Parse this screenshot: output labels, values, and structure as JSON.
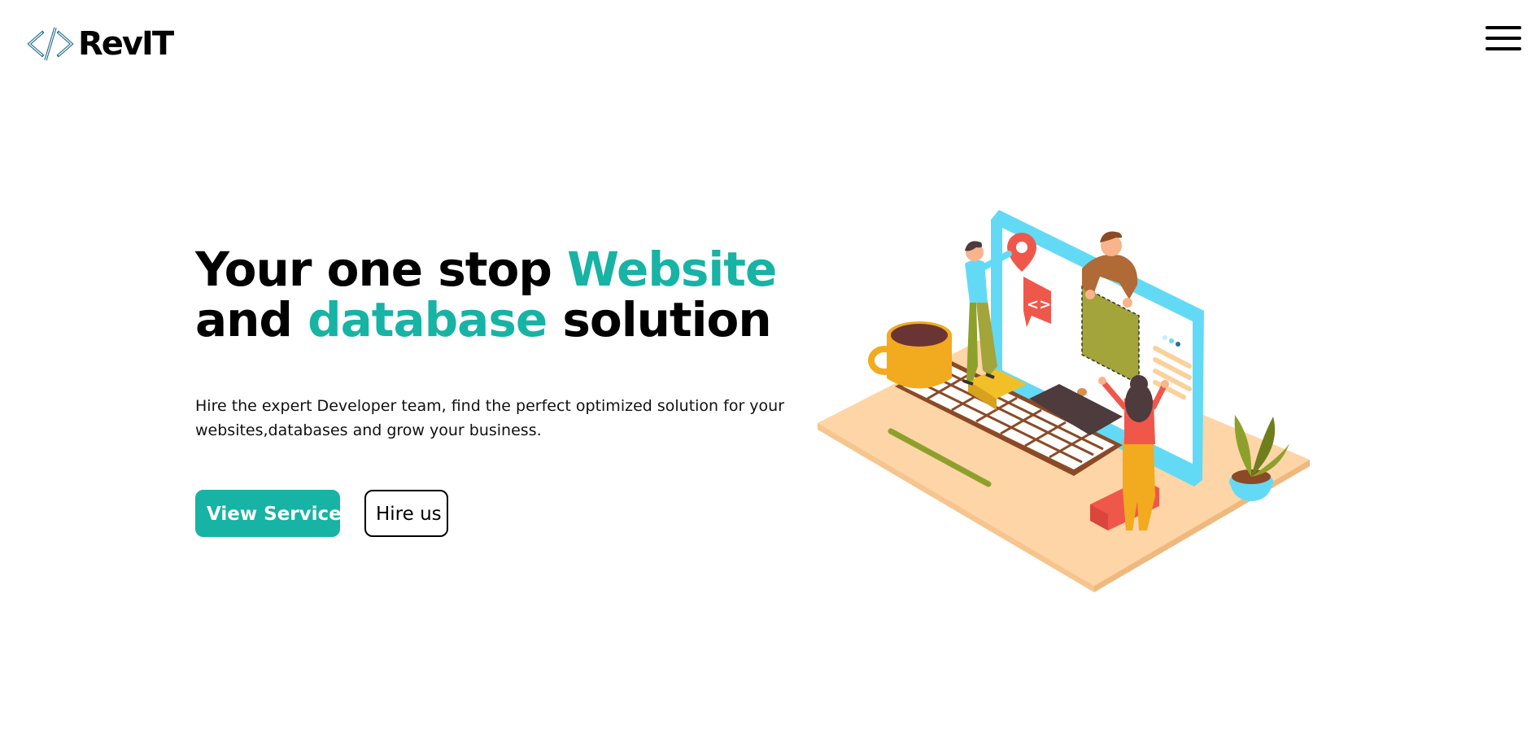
{
  "brand": {
    "name": "RevIT",
    "icon": "code-brackets-icon"
  },
  "header": {
    "menu_icon": "hamburger-menu-icon"
  },
  "hero": {
    "title_part1": "Your one stop ",
    "title_accent1": "Website",
    "title_part2": "and ",
    "title_accent2": "database",
    "title_part3": " solution",
    "description": "Hire the expert Developer team, find the perfect optimized solution for your websites,databases and grow your business.",
    "primary_button": "View Services",
    "secondary_button": "Hire us",
    "illustration_code_glyph": "<>"
  },
  "colors": {
    "accent": "#17b3a4",
    "text": "#000000",
    "background": "#ffffff",
    "platform": "#fdd5a6",
    "monitor": "#62daf5",
    "coral": "#f0574b",
    "olive": "#a3a43a",
    "mustard": "#f2aa1e",
    "brown": "#8b4a26"
  }
}
